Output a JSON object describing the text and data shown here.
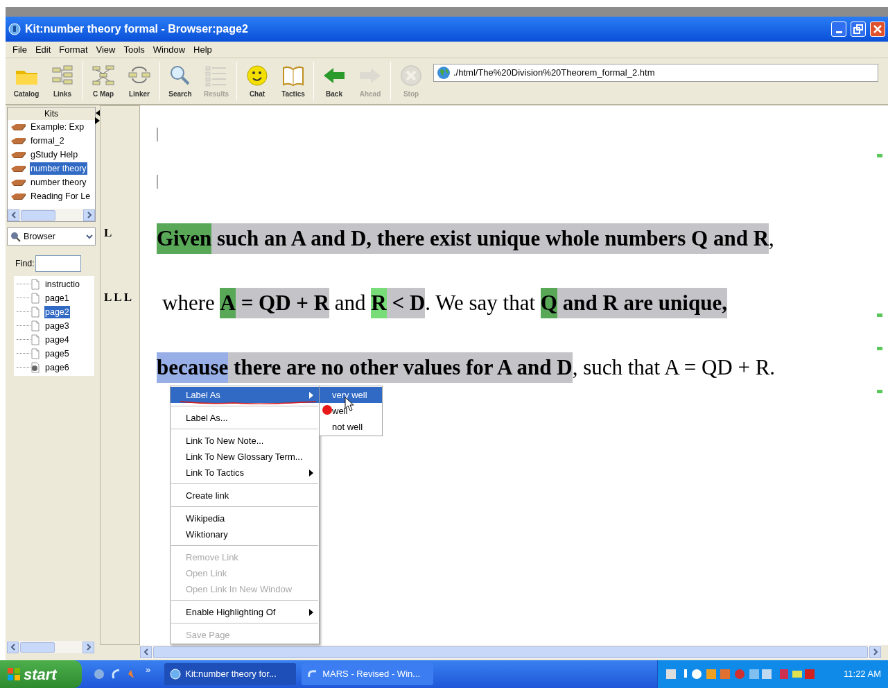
{
  "window": {
    "title": "Kit:number theory formal - Browser:page2"
  },
  "menu_bar": [
    "File",
    "Edit",
    "Format",
    "View",
    "Tools",
    "Window",
    "Help"
  ],
  "toolbar": [
    {
      "kind": "button",
      "label": "Catalog",
      "disabled": false
    },
    {
      "kind": "button",
      "label": "Links",
      "disabled": false
    },
    {
      "kind": "separator"
    },
    {
      "kind": "button",
      "label": "C Map",
      "disabled": false
    },
    {
      "kind": "button",
      "label": "Linker",
      "disabled": false
    },
    {
      "kind": "separator"
    },
    {
      "kind": "button",
      "label": "Search",
      "disabled": false
    },
    {
      "kind": "button",
      "label": "Results",
      "disabled": true
    },
    {
      "kind": "separator"
    },
    {
      "kind": "button",
      "label": "Chat",
      "disabled": false
    },
    {
      "kind": "button",
      "label": "Tactics",
      "disabled": false
    },
    {
      "kind": "separator"
    },
    {
      "kind": "button",
      "label": "Back",
      "disabled": false
    },
    {
      "kind": "button",
      "label": "Ahead",
      "disabled": true
    },
    {
      "kind": "separator"
    },
    {
      "kind": "button",
      "label": "Stop",
      "disabled": true
    }
  ],
  "address": {
    "value": "./html/The%20Division%20Theorem_formal_2.htm"
  },
  "kits": {
    "title": "Kits",
    "items": [
      {
        "label": "Example: Exp",
        "selected": false
      },
      {
        "label": "formal_2",
        "selected": false
      },
      {
        "label": "gStudy Help",
        "selected": false
      },
      {
        "label": "number theory",
        "selected": true
      },
      {
        "label": "number theory",
        "selected": false
      },
      {
        "label": "Reading For Le",
        "selected": false
      }
    ]
  },
  "browser": {
    "dropdown": "Browser",
    "find_label": "Find:",
    "pages": [
      {
        "label": "instructio",
        "selected": false,
        "kind": "page"
      },
      {
        "label": "page1",
        "selected": false,
        "kind": "page"
      },
      {
        "label": "page2",
        "selected": true,
        "kind": "page"
      },
      {
        "label": "page3",
        "selected": false,
        "kind": "page"
      },
      {
        "label": "page4",
        "selected": false,
        "kind": "page"
      },
      {
        "label": "page5",
        "selected": false,
        "kind": "page"
      },
      {
        "label": "page6",
        "selected": false,
        "kind": "marked"
      }
    ]
  },
  "lines": [
    {
      "gutter": "L",
      "segments": [
        {
          "text": "Given",
          "bold": true,
          "color": "#58a858"
        },
        {
          "text": " such an A and D, there exist unique whole numbers Q and R",
          "bold": true,
          "color": "#c4c4c8"
        },
        {
          "text": ",",
          "bold": false
        }
      ]
    },
    {
      "gutter": "LLL",
      "segments": [
        {
          "text": "where ",
          "bold": false
        },
        {
          "text": "A",
          "bold": true,
          "color": "#58a858"
        },
        {
          "text": " = QD + R",
          "bold": true,
          "color": "#c4c4c8"
        },
        {
          "text": " and ",
          "bold": false
        },
        {
          "text": "R",
          "bold": true,
          "color": "#78dc78"
        },
        {
          "text": " < D",
          "bold": true,
          "color": "#c4c4c8"
        },
        {
          "text": ". We say that ",
          "bold": false
        },
        {
          "text": "Q",
          "bold": true,
          "color": "#58a858"
        },
        {
          "text": " and R are unique,",
          "bold": true,
          "color": "#c4c4c8"
        }
      ]
    },
    {
      "segments": [
        {
          "text": "because",
          "bold": true,
          "color": "#98aee6"
        },
        {
          "text": " there are no other values for A and D",
          "bold": true,
          "color": "#c4c4c8"
        },
        {
          "text": ", such that A = QD + R.",
          "bold": false
        }
      ]
    }
  ],
  "context_menu": {
    "items": [
      {
        "kind": "item",
        "label": "Label As",
        "selected": true,
        "disabled": false,
        "submenu": true
      },
      {
        "kind": "separator"
      },
      {
        "kind": "item",
        "label": "Label As...",
        "selected": false,
        "disabled": false,
        "submenu": false
      },
      {
        "kind": "separator"
      },
      {
        "kind": "item",
        "label": "Link To New Note...",
        "selected": false,
        "disabled": false,
        "submenu": false
      },
      {
        "kind": "item",
        "label": "Link To New Glossary Term...",
        "selected": false,
        "disabled": false,
        "submenu": false
      },
      {
        "kind": "item",
        "label": "Link To Tactics",
        "selected": false,
        "disabled": false,
        "submenu": true
      },
      {
        "kind": "separator"
      },
      {
        "kind": "item",
        "label": "Create link",
        "selected": false,
        "disabled": false,
        "submenu": false
      },
      {
        "kind": "separator"
      },
      {
        "kind": "item",
        "label": "Wikipedia",
        "selected": false,
        "disabled": false,
        "submenu": false
      },
      {
        "kind": "item",
        "label": "Wiktionary",
        "selected": false,
        "disabled": false,
        "submenu": false
      },
      {
        "kind": "separator"
      },
      {
        "kind": "item",
        "label": "Remove Link",
        "selected": false,
        "disabled": true,
        "submenu": false
      },
      {
        "kind": "item",
        "label": "Open Link",
        "selected": false,
        "disabled": true,
        "submenu": false
      },
      {
        "kind": "item",
        "label": "Open Link In New Window",
        "selected": false,
        "disabled": true,
        "submenu": false
      },
      {
        "kind": "separator"
      },
      {
        "kind": "item",
        "label": "Enable Highlighting Of",
        "selected": false,
        "disabled": false,
        "submenu": true
      },
      {
        "kind": "separator"
      },
      {
        "kind": "item",
        "label": "Save Page",
        "selected": false,
        "disabled": true,
        "submenu": false
      }
    ]
  },
  "submenu": {
    "items": [
      {
        "label": "very well",
        "selected": true
      },
      {
        "label": "well",
        "selected": false
      },
      {
        "label": "not well",
        "selected": false
      }
    ]
  },
  "taskbar": {
    "start": "start",
    "overflow": "»",
    "tasks": [
      {
        "label": "Kit:number theory for...",
        "selected": true
      },
      {
        "label": "MARS - Revised - Win...",
        "selected": false
      }
    ],
    "clock": "11:22 AM"
  }
}
